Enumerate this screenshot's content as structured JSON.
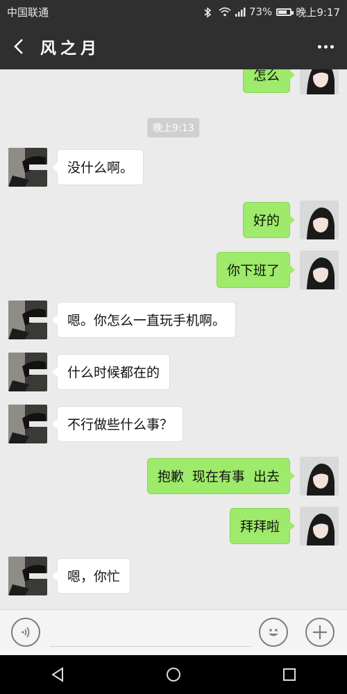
{
  "status_bar": {
    "carrier": "中国联通",
    "signal": "4G",
    "battery_percent_text": "73%",
    "battery_level": 0.73,
    "time": "晚上9:17"
  },
  "header": {
    "title": "风之月"
  },
  "chat": {
    "timestamp": "晚上9:13",
    "messages": [
      {
        "from": "me",
        "text": "怎么"
      },
      {
        "from": "them",
        "text": "没什么啊。"
      },
      {
        "from": "me",
        "text": "好的"
      },
      {
        "from": "me",
        "text": "你下班了"
      },
      {
        "from": "them",
        "text": "嗯。你怎么一直玩手机啊。"
      },
      {
        "from": "them",
        "text": "什么时候都在的"
      },
      {
        "from": "them",
        "text": "不行做些什么事？"
      },
      {
        "from": "me",
        "text": "抱歉  现在有事  出去"
      },
      {
        "from": "me",
        "text": "拜拜啦"
      },
      {
        "from": "them",
        "text": "嗯，你忙"
      }
    ]
  },
  "colors": {
    "header_bg": "#2f2f2f",
    "chat_bg": "#ebebeb",
    "my_bubble": "#9eea6a",
    "their_bubble": "#ffffff"
  },
  "icons": {
    "back": "chevron-left-icon",
    "more": "more-icon",
    "voice": "voice-icon",
    "emoji": "emoji-icon",
    "plus": "plus-icon"
  }
}
